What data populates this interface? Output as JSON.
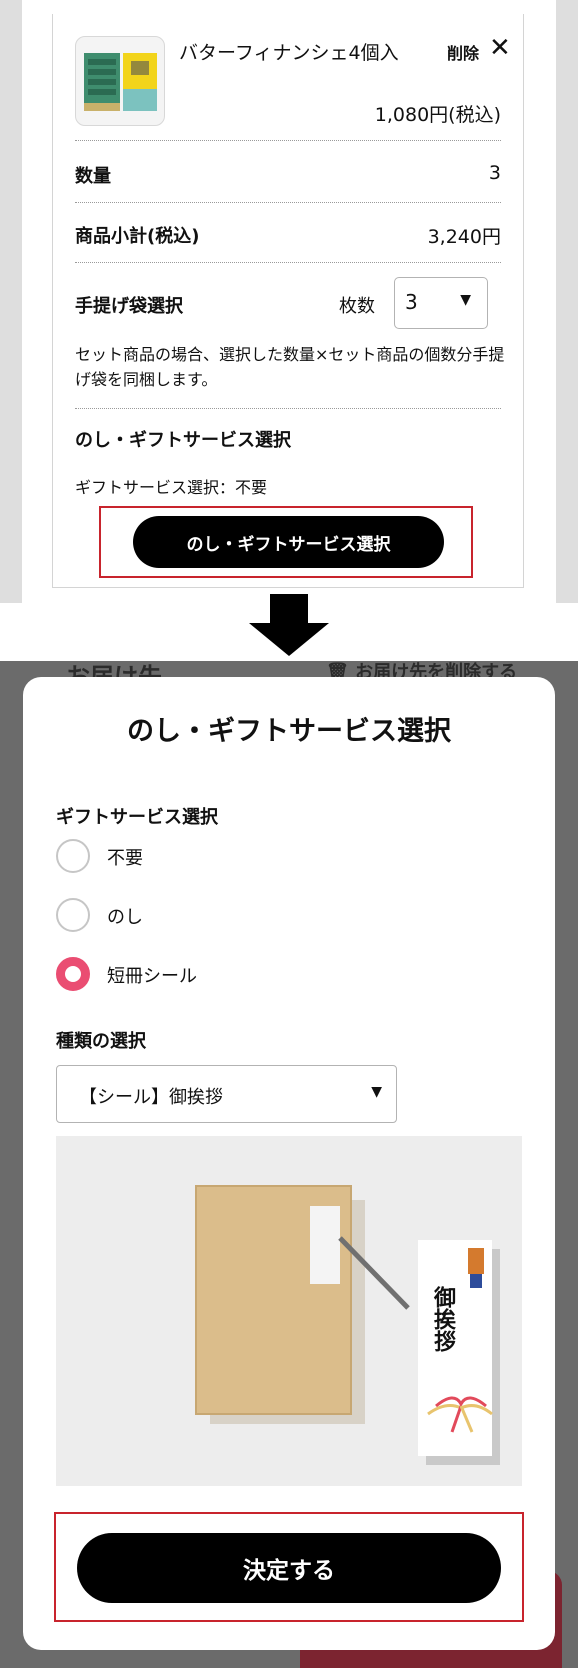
{
  "product": {
    "name": "バターフィナンシェ4個入",
    "delete_label": "削除",
    "close_glyph": "✕",
    "price": "1,080円(税込)"
  },
  "quantity": {
    "label": "数量",
    "value": "3"
  },
  "subtotal": {
    "label": "商品小計(税込)",
    "value": "3,240円"
  },
  "bag": {
    "label": "手提げ袋選択",
    "count_label": "枚数",
    "selected": "3",
    "note": "セット商品の場合、選択した数量×セット商品の個数分手提げ袋を同梱します。"
  },
  "gift": {
    "heading": "のし・ギフトサービス選択",
    "status": "ギフトサービス選択：不要",
    "button_label": "のし・ギフトサービス選択"
  },
  "background_page": {
    "delivery_label": "お届け先",
    "delete_delivery": "🗑 お届け先を削除する"
  },
  "modal": {
    "title": "のし・ギフトサービス選択",
    "service_label": "ギフトサービス選択",
    "options": [
      "不要",
      "のし",
      "短冊シール"
    ],
    "selected_option": "短冊シール",
    "type_label": "種類の選択",
    "type_selected": "【シール】御挨拶",
    "sticker_text": "御挨拶",
    "confirm_label": "決定する"
  },
  "colors": {
    "highlight_frame": "#c8242d",
    "radio_selected": "#ea4d72",
    "button_bg": "#000000",
    "overlay": "#6b6b6b"
  },
  "icons": [
    "dropdown-arrow-icon",
    "close-icon",
    "down-arrow-icon",
    "trash-icon",
    "radio-icon"
  ]
}
